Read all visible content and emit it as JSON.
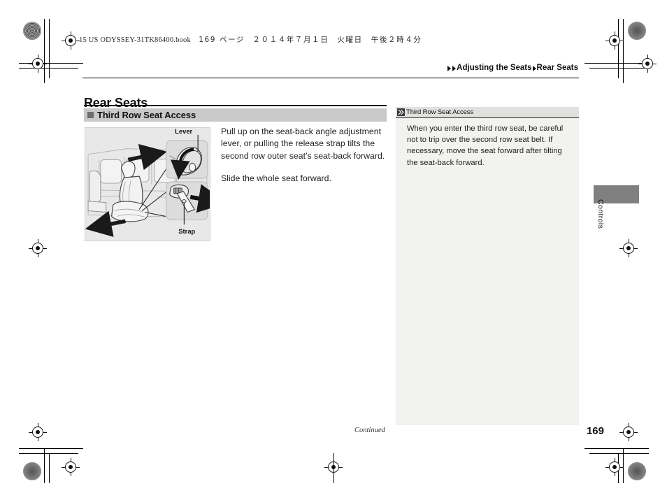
{
  "document": {
    "production_line": "15 US ODYSSEY-31TK86400.book",
    "production_page": "169 ページ",
    "production_date": "２０１４年７月１日　火曜日　午後２時４分",
    "page_number": "169",
    "continued_label": "Continued",
    "side_tab_label": "Controls"
  },
  "breadcrumb": {
    "level1": "Adjusting the Seats",
    "level2": "Rear Seats"
  },
  "title": "Rear Seats",
  "section": {
    "heading": "Third Row Seat Access",
    "marker_icon": "filled-square-icon"
  },
  "body": {
    "paragraph1": "Pull up on the seat-back angle adjustment lever, or pulling the release strap tilts the second row outer seat’s seat-back forward.",
    "paragraph2": "Slide the whole seat forward."
  },
  "figure": {
    "caption_lever": "Lever",
    "caption_strap": "Strap",
    "alt": "Vehicle interior illustration showing second row seat with seat-back angle adjustment lever and release strap callouts"
  },
  "note": {
    "heading": "Third Row Seat Access",
    "heading_icon": "double-chevron-icon",
    "text": "When you enter the third row seat, be careful not to trip over the second row seat belt. If necessary, move the seat forward after tilting the seat-back forward."
  },
  "colors": {
    "section_bar": "#c9c9c9",
    "section_marker": "#6e6e6e",
    "note_background": "#f2f2f0",
    "note_header": "#e0e0de",
    "figure_background": "#e8e8e8",
    "side_tab": "#808080"
  }
}
